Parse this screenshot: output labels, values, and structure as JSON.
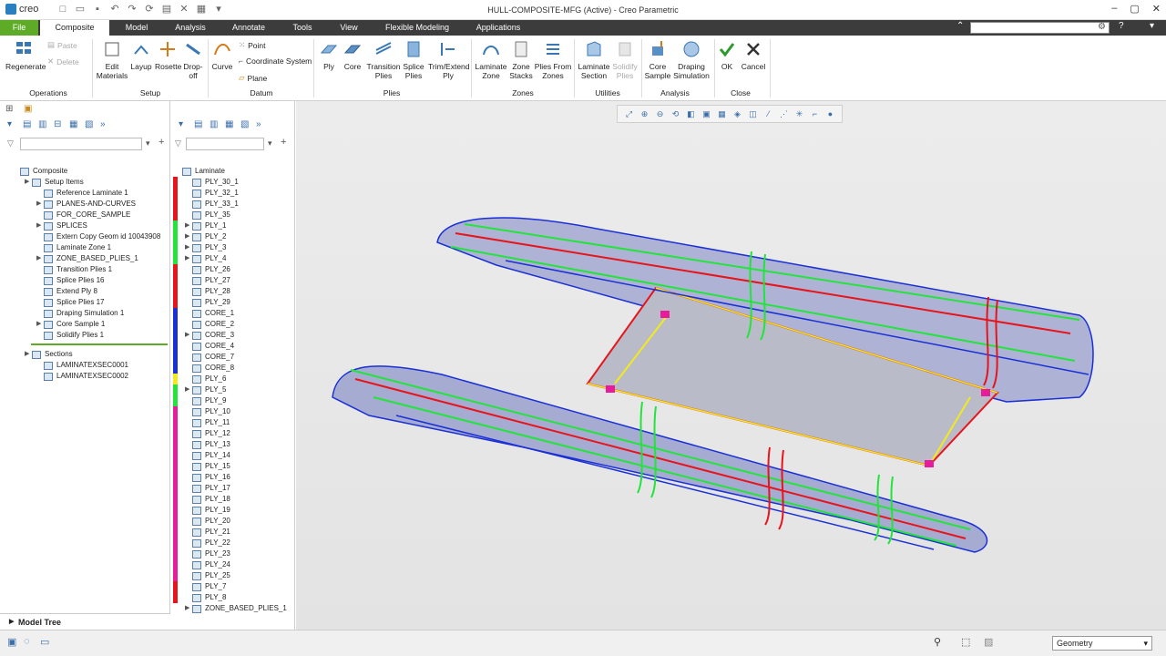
{
  "app": {
    "logo_text": "creo",
    "window_title": "HULL-COMPOSITE-MFG (Active) - Creo Parametric"
  },
  "menu": {
    "tabs": [
      "File",
      "Composite",
      "Model",
      "Analysis",
      "Annotate",
      "Tools",
      "View",
      "Flexible Modeling",
      "Applications"
    ],
    "active_tab": "Composite"
  },
  "ribbon": {
    "operations": {
      "regenerate": "Regenerate",
      "paste": "Paste",
      "delete": "Delete",
      "group": "Operations"
    },
    "setup": {
      "edit_materials": "Edit\nMaterials",
      "layup": "Layup",
      "rosette": "Rosette",
      "dropoff": "Drop-\noff",
      "group": "Setup"
    },
    "datum": {
      "curve": "Curve",
      "point": "Point",
      "coord_sys": "Coordinate System",
      "plane": "Plane",
      "group": "Datum"
    },
    "plies": {
      "ply": "Ply",
      "core": "Core",
      "transition": "Transition\nPlies",
      "splice": "Splice\nPlies",
      "trim_extend": "Trim/Extend\nPly",
      "group": "Plies"
    },
    "zones": {
      "laminate_zone": "Laminate\nZone",
      "zone_stacks": "Zone\nStacks",
      "plies_from_zones": "Plies From\nZones",
      "group": "Zones"
    },
    "utilities": {
      "laminate_section": "Laminate\nSection",
      "solidify_plies": "Solidify\nPlies",
      "group": "Utilities"
    },
    "analysis": {
      "core_sample": "Core\nSample",
      "draping_sim": "Draping\nSimulation",
      "group": "Analysis"
    },
    "close": {
      "ok": "OK",
      "cancel": "Cancel",
      "group": "Close"
    }
  },
  "model_tree": {
    "root": "Composite",
    "items": [
      {
        "label": "Setup Items",
        "expand": true,
        "indent": 1
      },
      {
        "label": "Reference Laminate 1",
        "expand": false,
        "indent": 2
      },
      {
        "label": "PLANES-AND-CURVES",
        "expand": true,
        "indent": 2
      },
      {
        "label": "FOR_CORE_SAMPLE",
        "expand": false,
        "indent": 2
      },
      {
        "label": "SPLICES",
        "expand": true,
        "indent": 2
      },
      {
        "label": "Extern Copy Geom id 10043908",
        "expand": false,
        "indent": 2
      },
      {
        "label": "Laminate Zone 1",
        "expand": false,
        "indent": 2
      },
      {
        "label": "ZONE_BASED_PLIES_1",
        "expand": true,
        "indent": 2
      },
      {
        "label": "Transition Plies 1",
        "expand": false,
        "indent": 2
      },
      {
        "label": "Splice Plies 16",
        "expand": false,
        "indent": 2
      },
      {
        "label": "Extend Ply 8",
        "expand": false,
        "indent": 2
      },
      {
        "label": "Splice Plies 17",
        "expand": false,
        "indent": 2
      },
      {
        "label": "Draping Simulation 1",
        "expand": false,
        "indent": 2
      },
      {
        "label": "Core Sample 1",
        "expand": true,
        "indent": 2
      },
      {
        "label": "Solidify Plies 1",
        "expand": false,
        "indent": 2
      }
    ],
    "sections_label": "Sections",
    "sections": [
      "LAMINATEXSEC0001",
      "LAMINATEXSEC0002"
    ],
    "footer": "Model Tree"
  },
  "laminate_tree": {
    "root": "Laminate",
    "items": [
      {
        "label": "PLY_30_1",
        "color": "#e8141b"
      },
      {
        "label": "PLY_32_1",
        "color": "#e8141b"
      },
      {
        "label": "PLY_33_1",
        "color": "#e8141b"
      },
      {
        "label": "PLY_35",
        "color": "#e8141b"
      },
      {
        "label": "PLY_1",
        "color": "#22e43a"
      },
      {
        "label": "PLY_2",
        "color": "#22e43a"
      },
      {
        "label": "PLY_3",
        "color": "#22e43a"
      },
      {
        "label": "PLY_4",
        "color": "#22e43a"
      },
      {
        "label": "PLY_26",
        "color": "#e8141b"
      },
      {
        "label": "PLY_27",
        "color": "#e8141b"
      },
      {
        "label": "PLY_28",
        "color": "#e8141b"
      },
      {
        "label": "PLY_29",
        "color": "#e8141b"
      },
      {
        "label": "CORE_1",
        "color": "#1a2fd6"
      },
      {
        "label": "CORE_2",
        "color": "#1a2fd6"
      },
      {
        "label": "CORE_3",
        "color": "#1a2fd6"
      },
      {
        "label": "CORE_4",
        "color": "#1a2fd6"
      },
      {
        "label": "CORE_7",
        "color": "#1a2fd6"
      },
      {
        "label": "CORE_8",
        "color": "#1a2fd6"
      },
      {
        "label": "PLY_6",
        "color": "#f2ea1a"
      },
      {
        "label": "PLY_5",
        "color": "#22e43a"
      },
      {
        "label": "PLY_9",
        "color": "#22e43a"
      },
      {
        "label": "PLY_10",
        "color": "#e81b9c"
      },
      {
        "label": "PLY_11",
        "color": "#e81b9c"
      },
      {
        "label": "PLY_12",
        "color": "#e81b9c"
      },
      {
        "label": "PLY_13",
        "color": "#e81b9c"
      },
      {
        "label": "PLY_14",
        "color": "#e81b9c"
      },
      {
        "label": "PLY_15",
        "color": "#e81b9c"
      },
      {
        "label": "PLY_16",
        "color": "#e81b9c"
      },
      {
        "label": "PLY_17",
        "color": "#e81b9c"
      },
      {
        "label": "PLY_18",
        "color": "#e81b9c"
      },
      {
        "label": "PLY_19",
        "color": "#e81b9c"
      },
      {
        "label": "PLY_20",
        "color": "#e81b9c"
      },
      {
        "label": "PLY_21",
        "color": "#e81b9c"
      },
      {
        "label": "PLY_22",
        "color": "#e81b9c"
      },
      {
        "label": "PLY_23",
        "color": "#e81b9c"
      },
      {
        "label": "PLY_24",
        "color": "#e81b9c"
      },
      {
        "label": "PLY_25",
        "color": "#e81b9c"
      },
      {
        "label": "PLY_7",
        "color": "#e8141b"
      },
      {
        "label": "PLY_8",
        "color": "#e8141b"
      }
    ],
    "last_item": "ZONE_BASED_PLIES_1"
  },
  "status": {
    "filter_value": "Geometry"
  }
}
